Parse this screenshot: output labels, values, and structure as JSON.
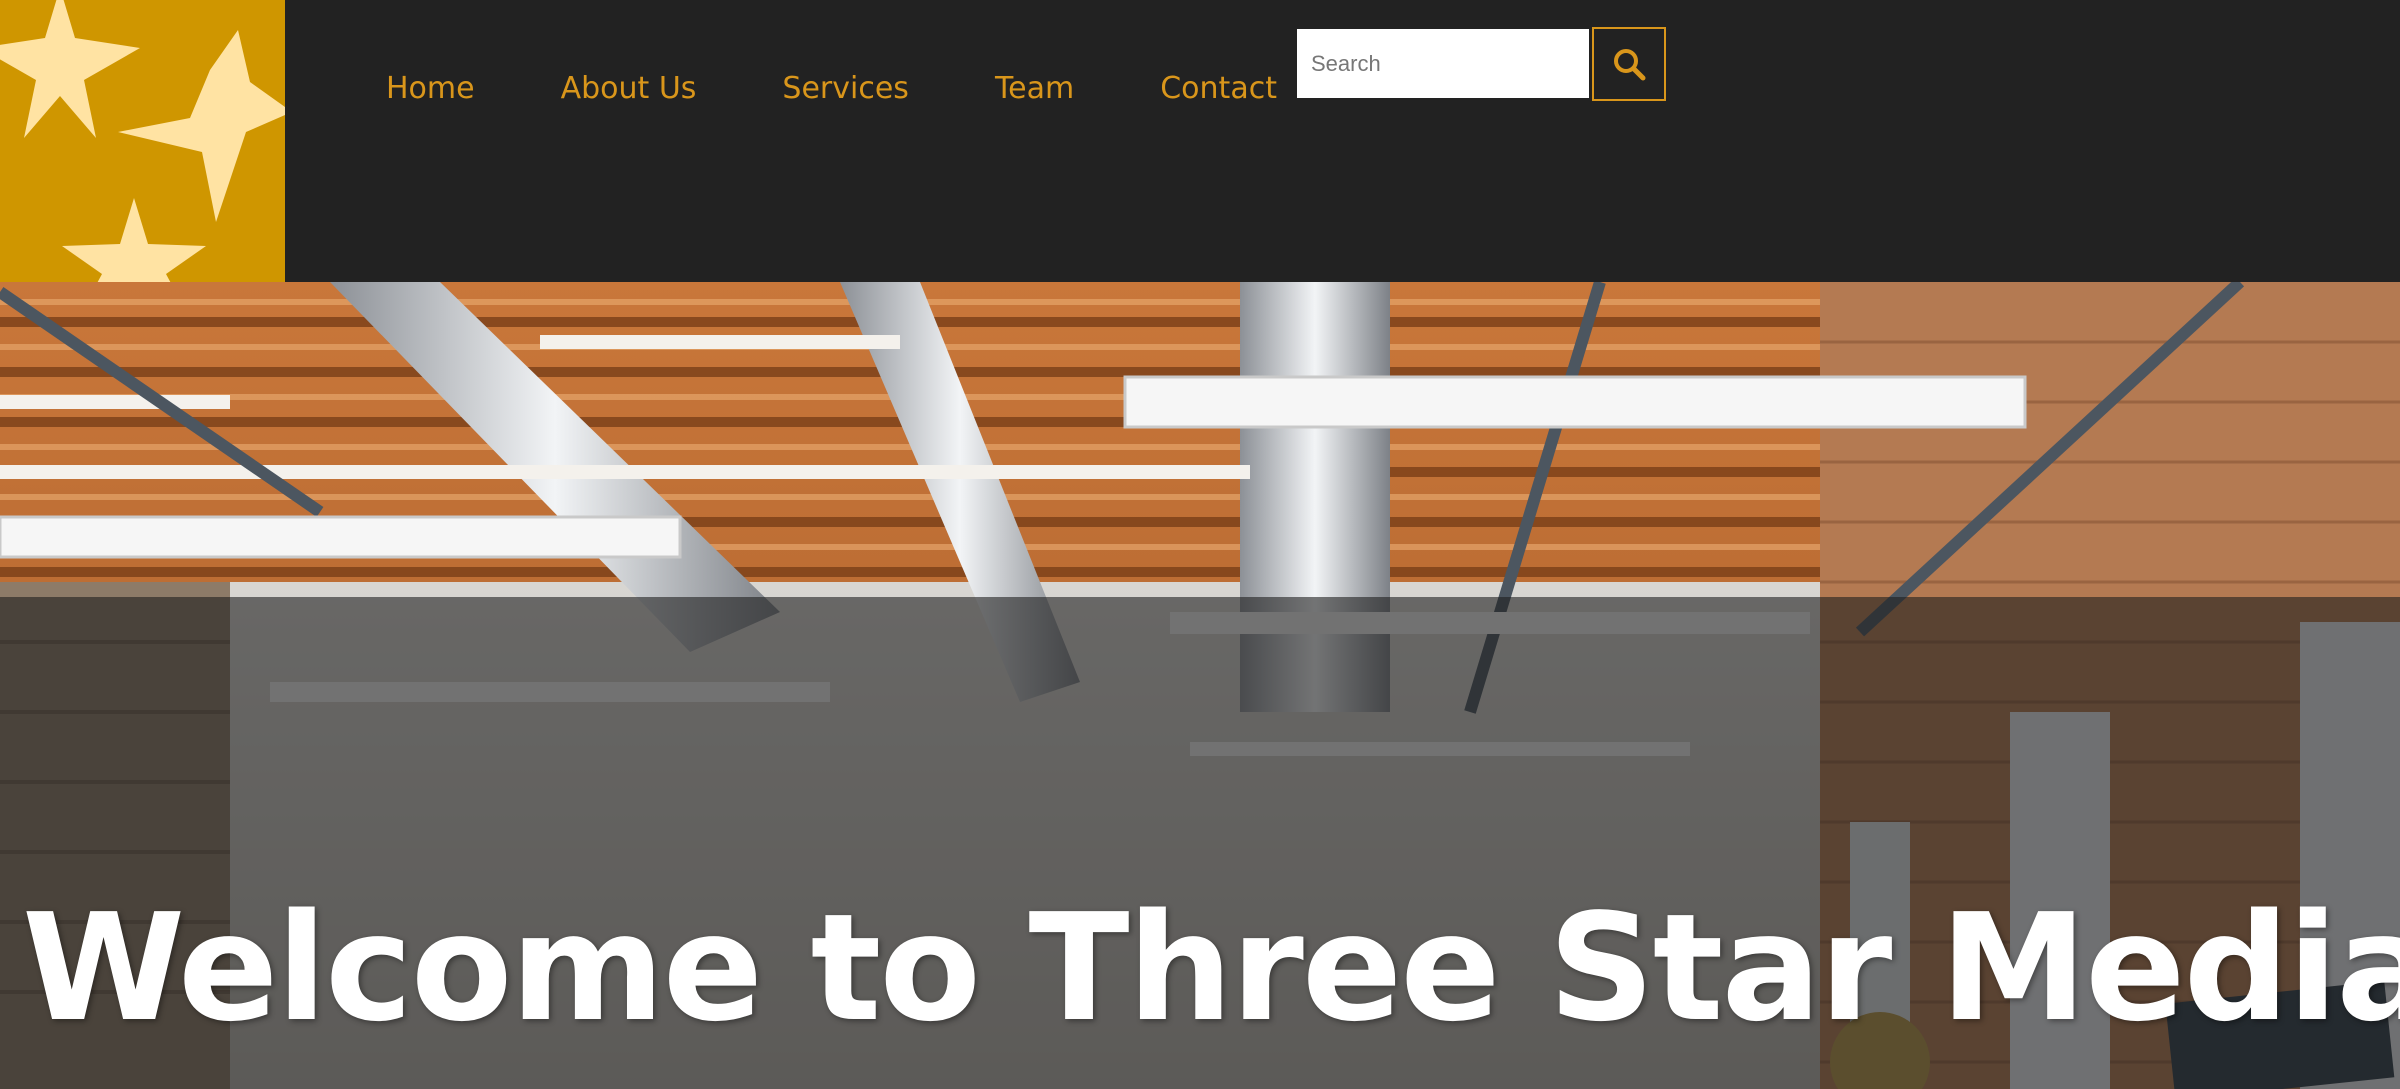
{
  "brand": {
    "logo_icon": "three-stars-logo",
    "logo_bg": "#cf9600",
    "star_color": "#ffe3a3"
  },
  "nav": {
    "items": [
      {
        "label": "Home"
      },
      {
        "label": "About Us"
      },
      {
        "label": "Services"
      },
      {
        "label": "Team"
      },
      {
        "label": "Contact"
      }
    ],
    "color": "#d9961b"
  },
  "search": {
    "placeholder": "Search",
    "value": "",
    "button_icon": "search-icon"
  },
  "hero": {
    "title": "Welcome to Three Star Media",
    "image": "office-interior-with-exposed-ceiling-ducts"
  }
}
